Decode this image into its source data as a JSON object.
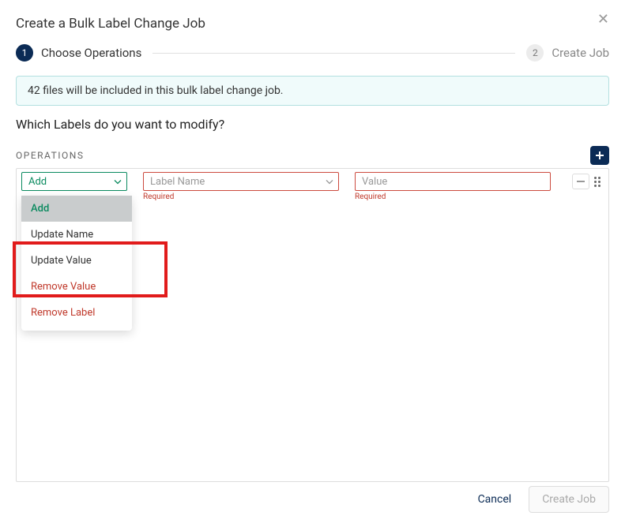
{
  "dialog": {
    "title": "Create a Bulk Label Change Job",
    "close_icon_label": "close"
  },
  "stepper": {
    "step1_num": "1",
    "step1_label": "Choose Operations",
    "step2_num": "2",
    "step2_label": "Create Job"
  },
  "banner": {
    "text": "42 files will be included in this bulk label change job."
  },
  "question": "Which Labels do you want to modify?",
  "operations": {
    "header": "OPERATIONS",
    "selected_op": "Add",
    "label_placeholder": "Label Name",
    "value_placeholder": "Value",
    "required_text": "Required",
    "dropdown": {
      "items": [
        {
          "label": "Add",
          "kind": "selected"
        },
        {
          "label": "Update Name",
          "kind": "normal"
        },
        {
          "label": "Update Value",
          "kind": "normal"
        },
        {
          "label": "Remove Value",
          "kind": "danger"
        },
        {
          "label": "Remove Label",
          "kind": "danger"
        }
      ]
    }
  },
  "footer": {
    "cancel": "Cancel",
    "create": "Create Job"
  }
}
